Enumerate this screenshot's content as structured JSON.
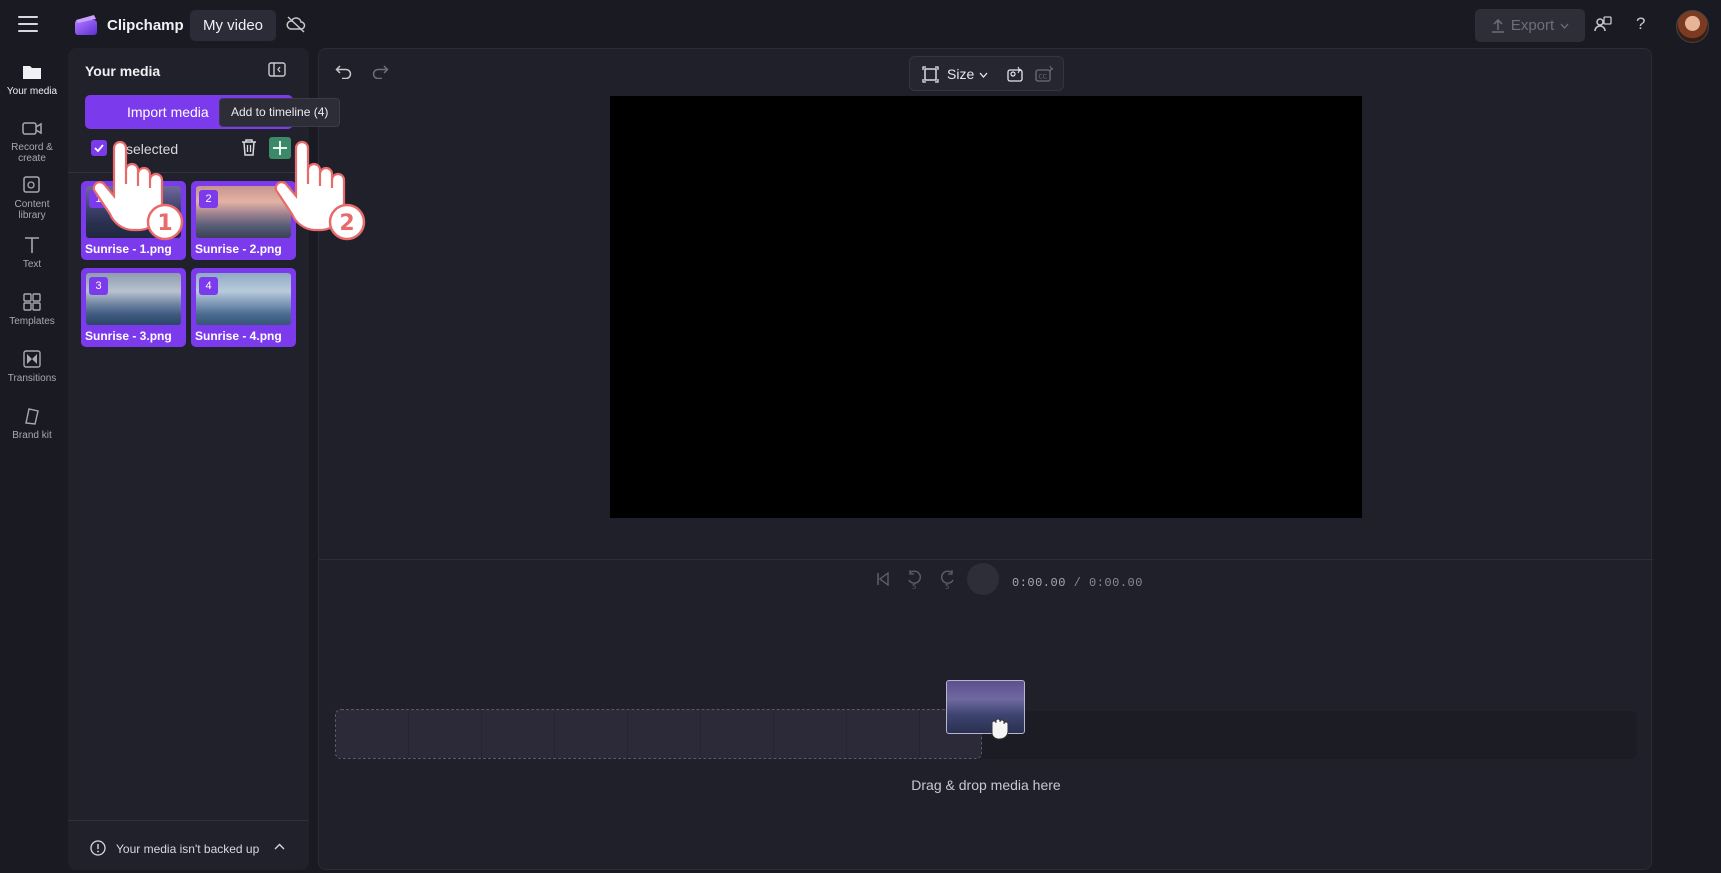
{
  "header": {
    "app_name": "Clipchamp",
    "video_title": "My video",
    "export_label": "Export"
  },
  "nav": {
    "items": [
      {
        "label": "Your media",
        "icon": "folder-icon",
        "active": true
      },
      {
        "label": "Record & create",
        "icon": "camera-icon"
      },
      {
        "label": "Content library",
        "icon": "library-icon"
      },
      {
        "label": "Text",
        "icon": "text-icon"
      },
      {
        "label": "Templates",
        "icon": "templates-icon"
      },
      {
        "label": "Transitions",
        "icon": "transitions-icon"
      },
      {
        "label": "Brand kit",
        "icon": "brand-kit-icon"
      }
    ]
  },
  "media_panel": {
    "title": "Your media",
    "import_label": "Import media",
    "tooltip": "Add to timeline (4)",
    "selected_label": "selected",
    "items": [
      {
        "number": "1",
        "name": "Sunrise - 1.png"
      },
      {
        "number": "2",
        "name": "Sunrise - 2.png"
      },
      {
        "number": "3",
        "name": "Sunrise - 3.png"
      },
      {
        "number": "4",
        "name": "Sunrise - 4.png"
      }
    ],
    "backup_text": "Your media isn't backed up"
  },
  "editor": {
    "size_label": "Size",
    "time_current": "0:00.00",
    "time_separator": " / ",
    "time_total": "0:00.00",
    "drop_label": "Drag & drop media here"
  },
  "annotations": {
    "step1": "1",
    "step2": "2"
  },
  "colors": {
    "accent": "#7c3aed",
    "add_button": "#3a8a6a",
    "background": "#1a1a22"
  }
}
